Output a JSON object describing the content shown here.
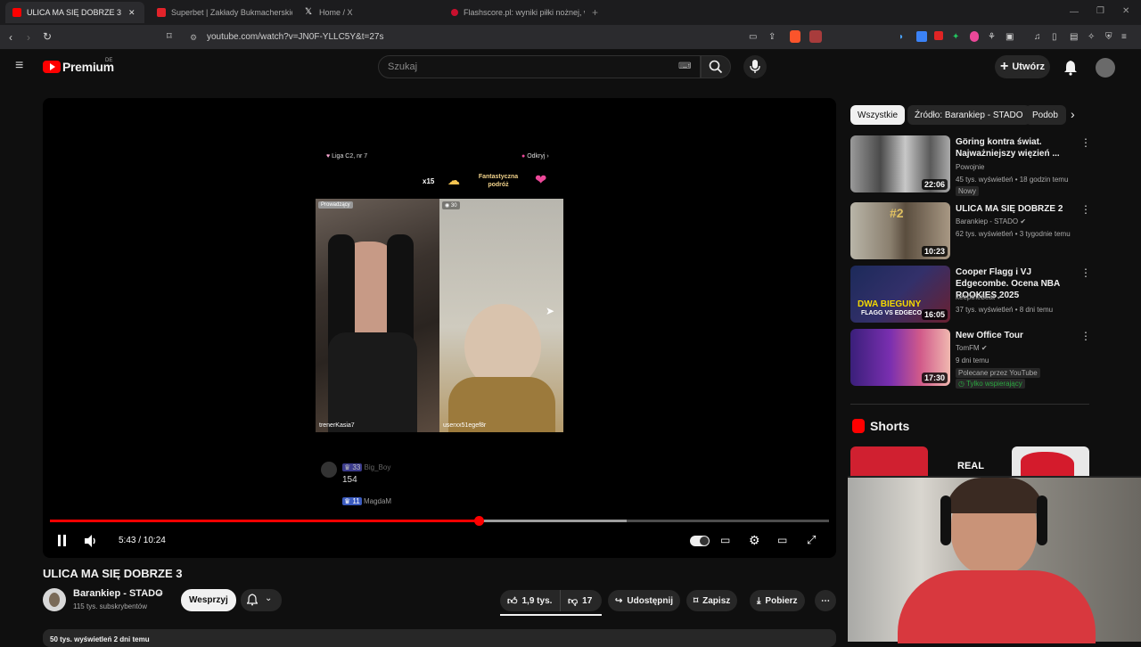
{
  "browser": {
    "tabs": [
      {
        "label": "ULICA MA SIĘ DOBRZE 3 - Yo",
        "active": true
      },
      {
        "label": "Superbet | Zakłady Bukmacherskie O"
      },
      {
        "label": "Home / X"
      },
      {
        "label": "Flashscore.pl: wyniki piłki nożnej, wy"
      }
    ],
    "new_tab": "+",
    "url": "youtube.com/watch?v=JN0F-YLLC5Y&t=27s"
  },
  "header": {
    "logo_text": "Premium",
    "logo_badge": "DE",
    "search_placeholder": "Szukaj",
    "create_label": "Utwórz"
  },
  "video": {
    "overlay": {
      "league": "Liga C2, nr 7",
      "discover": "Odkryj",
      "multiplier": "x15",
      "gift_text": "Fantastyczna podróż",
      "host_badge": "Prowadzący",
      "viewer_count": "30",
      "left_name": "trenerKasia7",
      "right_name": "userxx51egef8r",
      "chat_user1": "Big_Boy",
      "chat_badge1": "33",
      "chat_msg1": "154",
      "chat_badge2": "11",
      "chat_user2": "MagdaM"
    },
    "time": "5:43 / 10:24",
    "progress": 0.55,
    "buffered": 0.74
  },
  "info": {
    "title": "ULICA MA SIĘ DOBRZE 3",
    "channel": "Barankiep - STADO",
    "subscribers": "115 tys. subskrybentów",
    "support": "Wesprzyj",
    "likes": "1,9 tys.",
    "dislikes": "17",
    "share": "Udostępnij",
    "save": "Zapisz",
    "download": "Pobierz",
    "views": "50 tys. wyświetleń  2 dni temu"
  },
  "chips": [
    "Wszystkie",
    "Źródło: Barankiep - STADO",
    "Podob"
  ],
  "related": [
    {
      "title": "Göring kontra świat. Najważniejszy więzień ...",
      "channel": "Powojnie",
      "meta": "45 tys. wyświetleń • 18 godzin temu",
      "tag": "Nowy",
      "duration": "22:06"
    },
    {
      "title": "ULICA MA SIĘ DOBRZE 2",
      "channel": "Barankiep - STADO",
      "meta": "62 tys. wyświetleń • 3 tygodnie temu",
      "duration": "10:23"
    },
    {
      "title": "Cooper Flagg i VJ Edgecombe. Ocena NBA ROOKIES 2025",
      "channel": "keepthebeat",
      "meta": "37 tys. wyświetleń • 8 dni temu",
      "duration": "16:05",
      "thumb_text": "DWA BIEGUNY",
      "thumb_text2": "FLAGG VS EDGECO"
    },
    {
      "title": "New Office Tour",
      "channel": "TomFM",
      "meta": "9 dni temu",
      "tag": "Polecane przez YouTube",
      "tag2": "Tylko wspierający",
      "duration": "17:30"
    }
  ],
  "shorts": {
    "heading": "Shorts",
    "card_text": "REAL"
  },
  "colors": {
    "accent": "#ff0000",
    "bg": "#0f0f0f",
    "chip": "#272727"
  }
}
